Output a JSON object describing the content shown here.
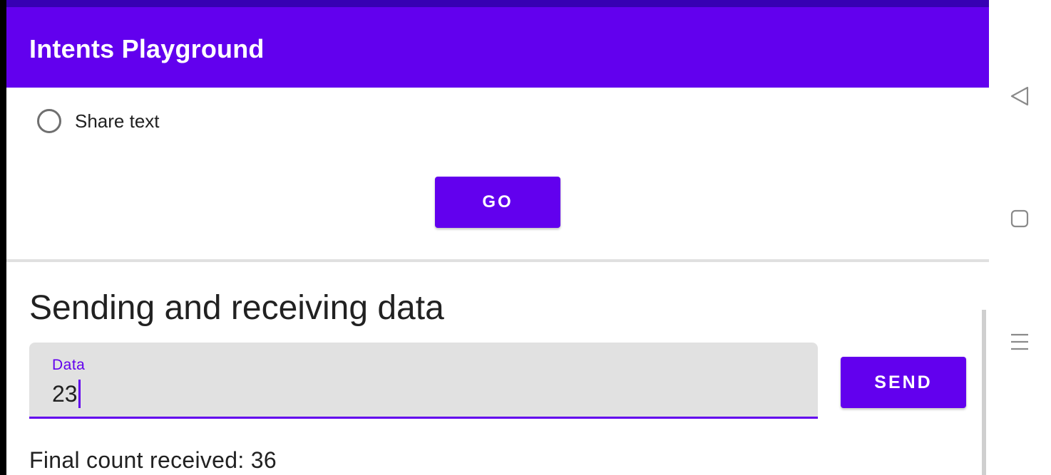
{
  "app_bar": {
    "title": "Intents Playground"
  },
  "radio": {
    "label": "Share text",
    "checked": false
  },
  "go_button": {
    "label": "GO"
  },
  "section": {
    "title": "Sending and receiving data"
  },
  "data_field": {
    "label": "Data",
    "value": "23"
  },
  "send_button": {
    "label": "SEND"
  },
  "result": {
    "final_count_text": "Final count received: 36"
  },
  "nav": {
    "icons": [
      "back-icon",
      "home-icon",
      "menu-icon"
    ]
  },
  "colors": {
    "primary": "#6200ee",
    "primary_dark": "#3700b3",
    "field_bg": "#e1e1e1",
    "text": "#212121"
  }
}
